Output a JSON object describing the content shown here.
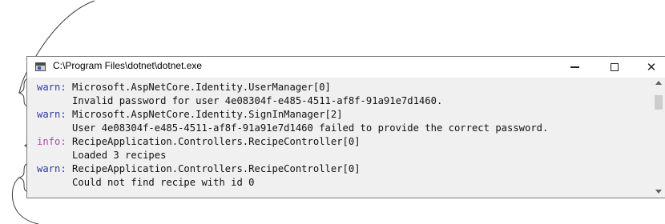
{
  "window": {
    "title": "C:\\Program Files\\dotnet\\dotnet.exe",
    "icon": "console-app-icon",
    "controls": {
      "minimize": "minimize-icon",
      "maximize": "maximize-icon",
      "close": "close-icon"
    }
  },
  "console": {
    "lines": [
      {
        "level": "warn",
        "level_label": "warn:",
        "text": " Microsoft.AspNetCore.Identity.UserManager[0]"
      },
      {
        "level": "",
        "level_label": "",
        "text": "      Invalid password for user 4e08304f-e485-4511-af8f-91a91e7d1460."
      },
      {
        "level": "warn",
        "level_label": "warn:",
        "text": " Microsoft.AspNetCore.Identity.SignInManager[2]"
      },
      {
        "level": "",
        "level_label": "",
        "text": "      User 4e08304f-e485-4511-af8f-91a91e7d1460 failed to provide the correct password."
      },
      {
        "level": "info",
        "level_label": "info:",
        "text": " RecipeApplication.Controllers.RecipeController[0]"
      },
      {
        "level": "",
        "level_label": "",
        "text": "      Loaded 3 recipes"
      },
      {
        "level": "warn",
        "level_label": "warn:",
        "text": " RecipeApplication.Controllers.RecipeController[0]"
      },
      {
        "level": "",
        "level_label": "",
        "text": "      Could not find recipe with id 0"
      }
    ]
  },
  "colors": {
    "warn": "#2c3aa6",
    "info": "#b04aa8",
    "console_background": "#f0f0f0"
  }
}
